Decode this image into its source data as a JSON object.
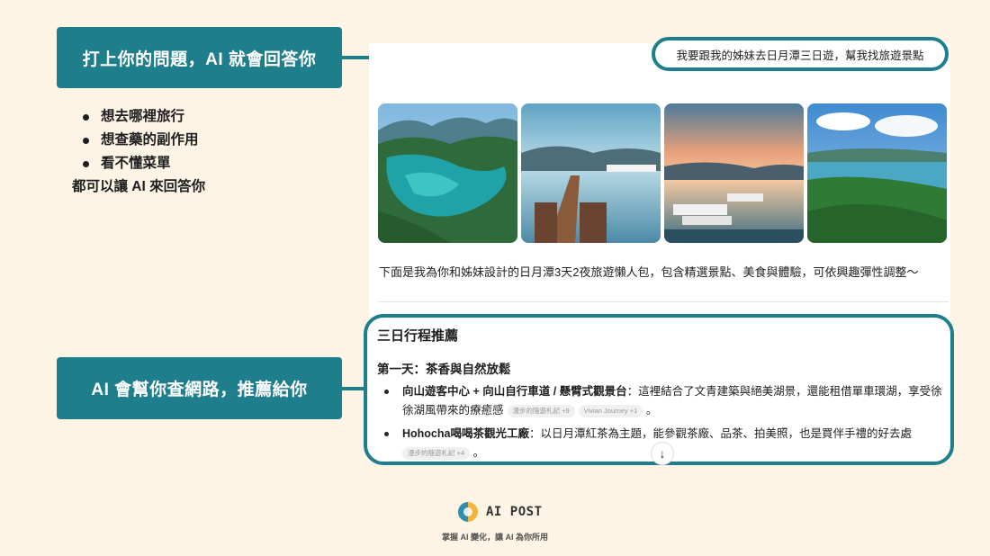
{
  "callouts": {
    "top": "打上你的問題，AI 就會回答你",
    "bottom": "AI 會幫你查網路，推薦給你"
  },
  "bullets": {
    "items": [
      "想去哪裡旅行",
      "想查藥的副作用",
      "看不懂菜單"
    ],
    "summary": "都可以讓 AI 來回答你"
  },
  "chat": {
    "query": "我要跟我的姊妹去日月潭三日遊，幫我找旅遊景點",
    "intro": "下面是我為你和姊妹設計的日月潭3天2夜旅遊懶人包，包含精選景點、美食與體驗，可依興趣彈性調整～",
    "section_title": "三日行程推薦",
    "day1_title": "第一天：茶香與自然放鬆",
    "item1_bold": "向山遊客中心 + 向山自行車道 / 懸臂式觀景台",
    "item1_text": "：這裡結合了文青建築與絕美湖景，還能租借單車環湖，享受徐徐湖風帶來的療癒感",
    "item1_chip1": "漫步的隨遊札記 +9",
    "item1_chip2": "Vivian Journey +1",
    "item1_end": "。",
    "item2_bold": "Hohocha喝喝茶觀光工廠",
    "item2_text": "：以日月潭紅茶為主題，能參觀茶廠、品茶、拍美照，也是買伴手禮的好去處",
    "item2_chip1": "漫步的隨遊札記 +4",
    "item2_end": "。",
    "scroll_icon": "↓"
  },
  "brand": {
    "name": "AI POST",
    "tagline": "掌握 AI 變化，讓 AI 為你所用"
  },
  "colors": {
    "accent": "#1f7e8c",
    "background": "#fdf4e5"
  }
}
